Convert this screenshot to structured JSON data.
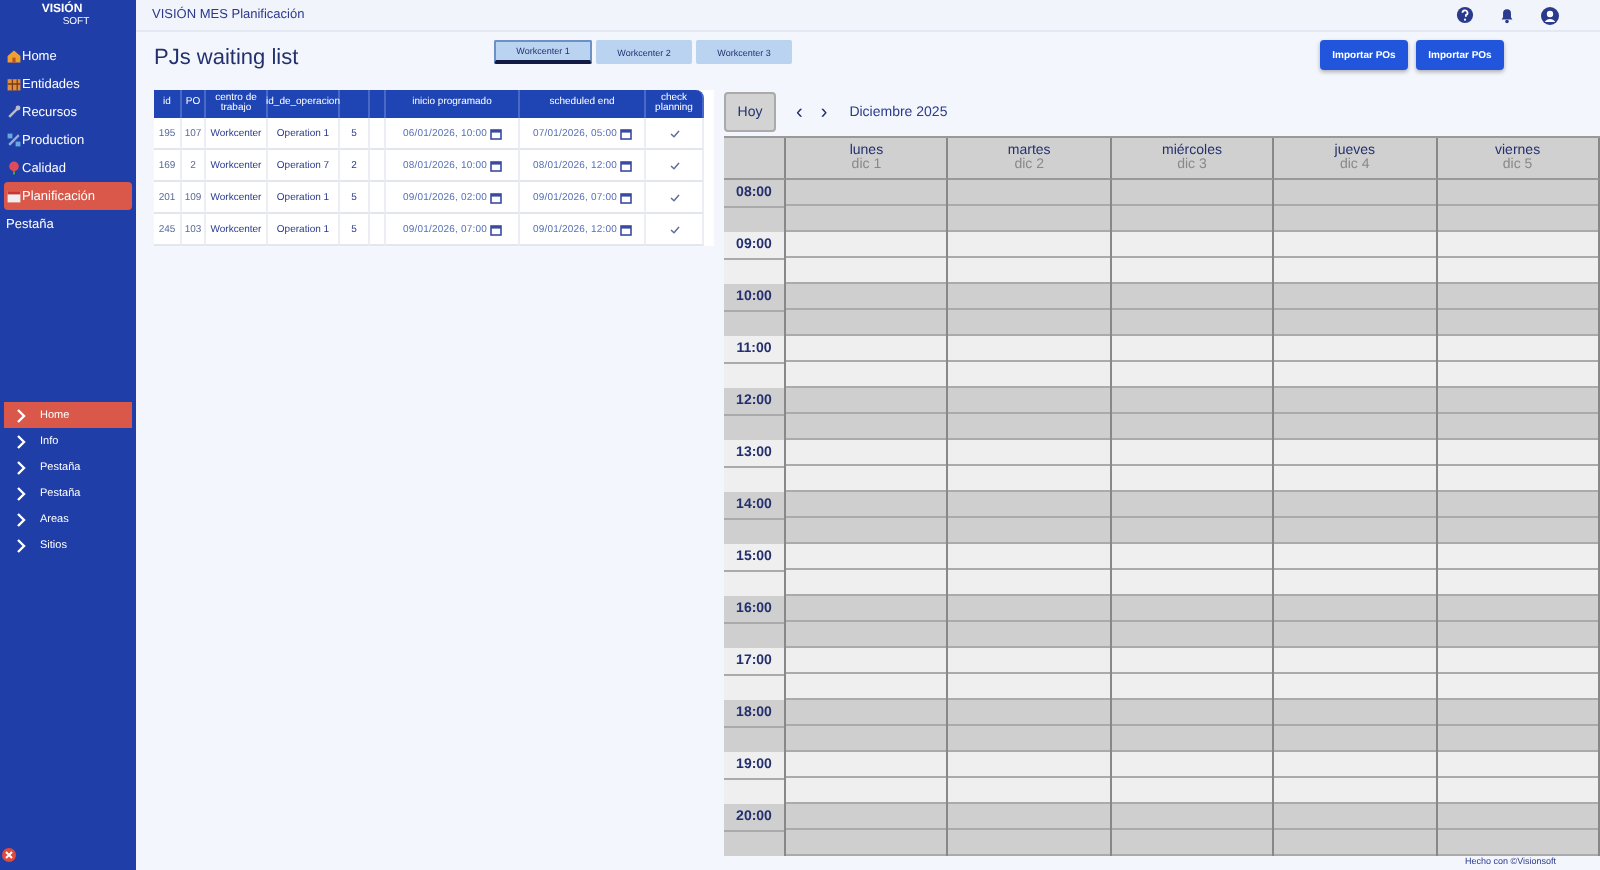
{
  "app": {
    "logo_top": "VISIÓN",
    "logo_bottom": "SOFT",
    "title": "VISIÓN MES Planificación"
  },
  "sidebar": {
    "items": [
      {
        "label": "Home",
        "selected": false
      },
      {
        "label": "Entidades",
        "selected": false
      },
      {
        "label": "Recursos",
        "selected": false
      },
      {
        "label": "Production",
        "selected": false
      },
      {
        "label": "Calidad",
        "selected": false
      },
      {
        "label": "Planificación",
        "selected": true
      },
      {
        "label": "Pestaña",
        "selected": false
      }
    ],
    "nav": [
      {
        "label": "Home",
        "selected": true
      },
      {
        "label": "Info",
        "selected": false
      },
      {
        "label": "Pestaña",
        "selected": false
      },
      {
        "label": "Pestaña",
        "selected": false
      },
      {
        "label": "Areas",
        "selected": false
      },
      {
        "label": "Sitios",
        "selected": false
      }
    ]
  },
  "page": {
    "title": "PJs waiting list",
    "workcenter_tabs": [
      {
        "label": "Workcenter 1",
        "selected": true
      },
      {
        "label": "Workcenter 2",
        "selected": false
      },
      {
        "label": "Workcenter 3",
        "selected": false
      }
    ],
    "buttons": [
      "Importar POs",
      "Importar POs"
    ]
  },
  "table": {
    "columns": [
      "id",
      "PO",
      "centro de trabajo",
      "id_de_operacion",
      "",
      "",
      "inicio programado",
      "scheduled end",
      "check planning"
    ],
    "rows": [
      {
        "cells": [
          "195",
          "107",
          "Workcenter",
          "Operation 1",
          "5",
          "",
          "06/01/2026, 10:00",
          "07/01/2026, 05:00"
        ],
        "checked": true
      },
      {
        "cells": [
          "169",
          "2",
          "Workcenter",
          "Operation 7",
          "2",
          "",
          "08/01/2026, 10:00",
          "08/01/2026, 12:00"
        ],
        "checked": true
      },
      {
        "cells": [
          "201",
          "109",
          "Workcenter",
          "Operation 1",
          "5",
          "",
          "09/01/2026, 02:00",
          "09/01/2026, 07:00"
        ],
        "checked": true
      },
      {
        "cells": [
          "245",
          "103",
          "Workcenter",
          "Operation 1",
          "5",
          "",
          "09/01/2026, 07:00",
          "09/01/2026, 12:00"
        ],
        "checked": true
      }
    ]
  },
  "calendar": {
    "today_button": "Hoy",
    "prev": "‹",
    "next": "›",
    "month": "Diciembre 2025",
    "days": [
      {
        "name": "lunes",
        "date": "dic 1"
      },
      {
        "name": "martes",
        "date": "dic 2"
      },
      {
        "name": "miércoles",
        "date": "dic 3"
      },
      {
        "name": "jueves",
        "date": "dic 4"
      },
      {
        "name": "viernes",
        "date": "dic 5"
      }
    ],
    "hours": [
      "08:00",
      "09:00",
      "10:00",
      "11:00",
      "12:00",
      "13:00",
      "14:00",
      "15:00",
      "16:00",
      "17:00",
      "18:00",
      "19:00",
      "20:00"
    ]
  },
  "footer": "Hecho con ©Visionsoft"
}
